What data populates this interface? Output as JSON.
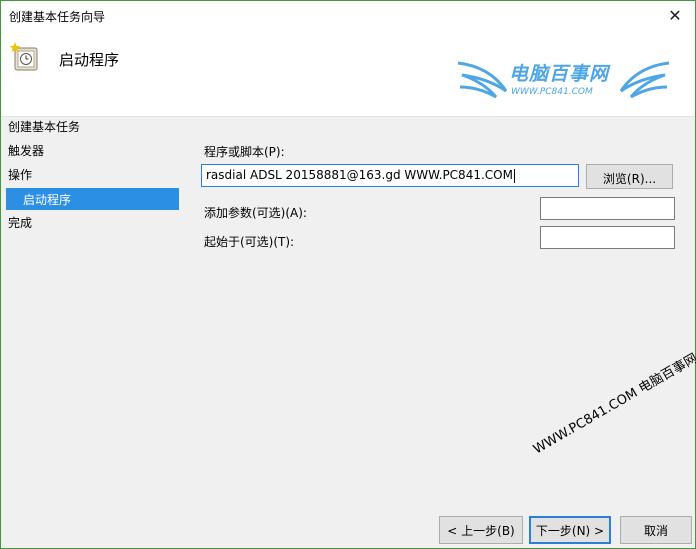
{
  "window": {
    "title": "创建基本任务向导",
    "close_glyph": "✕"
  },
  "header": {
    "title": "启动程序",
    "icon": "task-scheduler-icon"
  },
  "watermark": {
    "brand": "电脑百事网",
    "url": "WWW.PC841.COM",
    "diagonal": "WWW.PC841.COM 电脑百事网"
  },
  "nav": {
    "section": "创建基本任务",
    "items": [
      "触发器",
      "操作",
      "启动程序",
      "完成"
    ]
  },
  "form": {
    "program_label": "程序或脚本(P):",
    "program_value": "rasdial ADSL 20158881@163.gd WWW.PC841.COM",
    "browse_label": "浏览(R)...",
    "args_label": "添加参数(可选)(A):",
    "args_value": "",
    "start_in_label": "起始于(可选)(T):",
    "start_in_value": ""
  },
  "footer": {
    "back_label": "< 上一步(B)",
    "next_label": "下一步(N) >",
    "cancel_label": "取消"
  },
  "colors": {
    "accent": "#2b8fe3",
    "window_border": "#3c9a3c",
    "watermark": "#4fa6e6"
  }
}
